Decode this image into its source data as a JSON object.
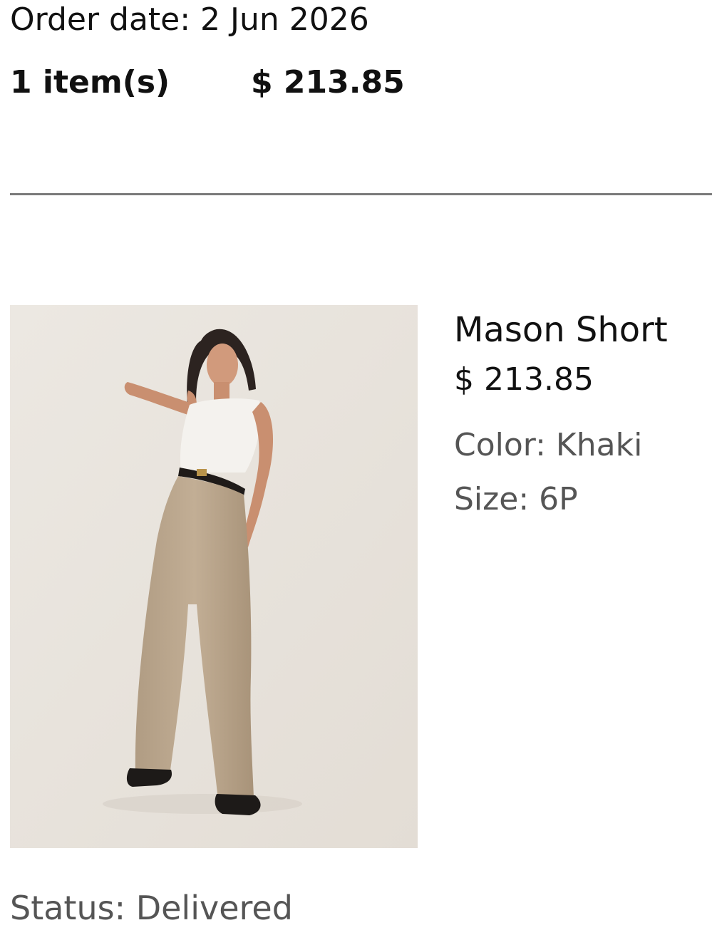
{
  "order": {
    "date_label": "Order date: 2 Jun 2026",
    "item_count": "1 item(s)",
    "total": "$ 213.85"
  },
  "product": {
    "name": "Mason Short",
    "price": "$ 213.85",
    "color": "Color: Khaki",
    "size": "Size: 6P",
    "image_icon": "product-photo"
  },
  "status": {
    "label": "Status: Delivered"
  },
  "colors": {
    "divider": "#7a7a7a",
    "image_bg": "#e9e4de",
    "muted_text": "#555555"
  }
}
